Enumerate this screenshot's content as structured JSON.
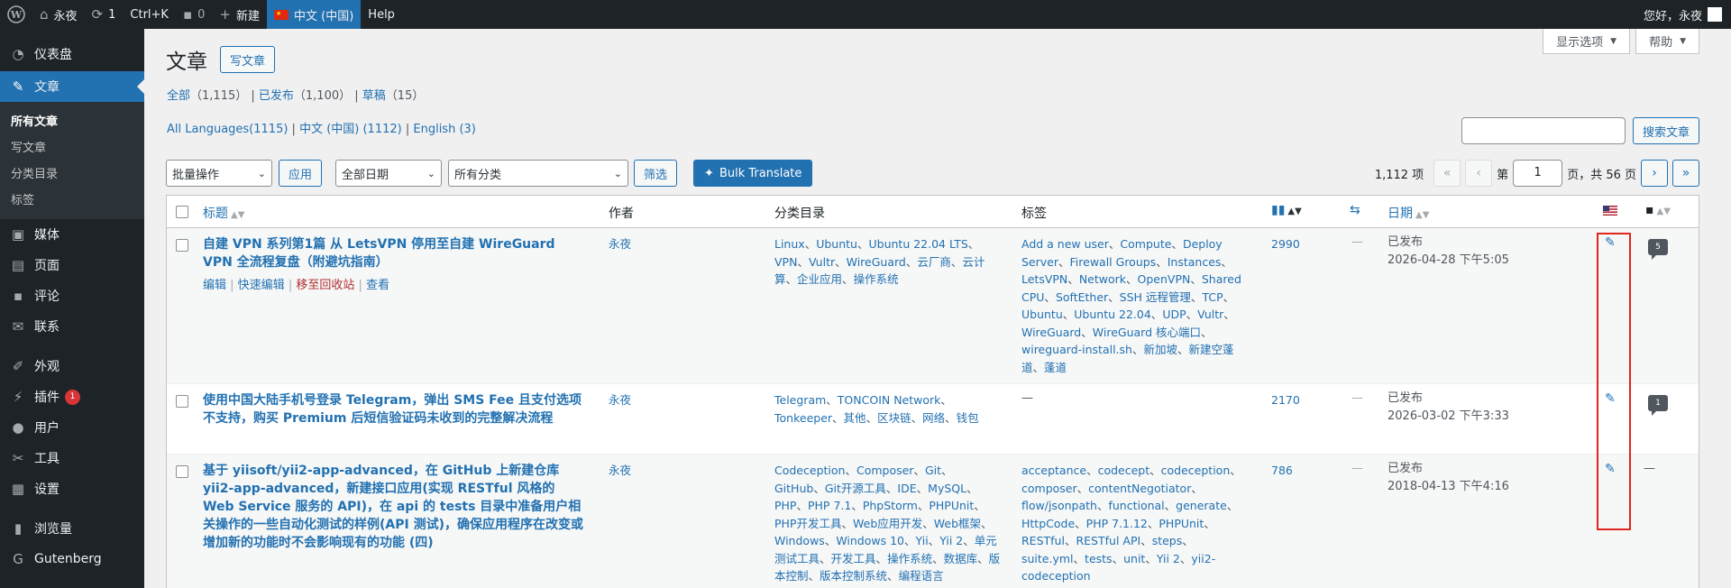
{
  "adminbar": {
    "site_name": "永夜",
    "updates_count": "1",
    "shortcut": "Ctrl+K",
    "comments_count": "0",
    "new_label": "新建",
    "language_label": "中文 (中国)",
    "help_label": "Help",
    "greeting": "您好，永夜"
  },
  "sidebar": {
    "dashboard": "仪表盘",
    "posts": "文章",
    "sub": {
      "all_posts": "所有文章",
      "new_post": "写文章",
      "categories": "分类目录",
      "tags": "标签"
    },
    "media": "媒体",
    "pages": "页面",
    "comments": "评论",
    "contact": "联系",
    "appearance": "外观",
    "plugins": "插件",
    "plugins_badge": "1",
    "users": "用户",
    "tools": "工具",
    "settings": "设置",
    "views": "浏览量",
    "gutenberg": "Gutenberg"
  },
  "screen_meta": {
    "options": "显示选项",
    "help": "帮助"
  },
  "page": {
    "title": "文章",
    "add_new": "写文章"
  },
  "views": {
    "all": "全部",
    "all_count": "（1,115）",
    "published": "已发布",
    "published_count": "（1,100）",
    "drafts": "草稿",
    "drafts_count": "（15）"
  },
  "languages": {
    "all": "All Languages(1115)",
    "zh": "中文 (中国)",
    "zh_count": "(1112)",
    "en": "English",
    "en_count": "(3)"
  },
  "search": {
    "value": "",
    "button": "搜索文章"
  },
  "tablenav": {
    "bulk_action": "批量操作",
    "apply": "应用",
    "date_filter": "全部日期",
    "category_filter": "所有分类",
    "filter": "筛选",
    "bulk_translate": "Bulk Translate",
    "items": "1,112 项",
    "first": "«",
    "prev": "‹",
    "page_prefix": "第",
    "current_page": "1",
    "page_suffix": "页，共 56 页",
    "next": "›",
    "last": "»"
  },
  "columns": {
    "title": "标题",
    "author": "作者",
    "categories": "分类目录",
    "tags": "标签",
    "date": "日期"
  },
  "row_actions": {
    "edit": "编辑",
    "quick_edit": "快速编辑",
    "trash": "移至回收站",
    "view": "查看"
  },
  "posts": [
    {
      "title": "自建 VPN 系列第1篇 从 LetsVPN 停用至自建 WireGuard VPN 全流程复盘（附避坑指南）",
      "author": "永夜",
      "categories": [
        "Linux",
        "Ubuntu",
        "Ubuntu 22.04 LTS",
        "VPN",
        "Vultr",
        "WireGuard",
        "云厂商",
        "云计算",
        "企业应用",
        "操作系统"
      ],
      "tags": [
        "Add a new user",
        "Compute",
        "Deploy Server",
        "Firewall Groups",
        "Instances",
        "LetsVPN",
        "Network",
        "OpenVPN",
        "Shared CPU",
        "SoftEther",
        "SSH 远程管理",
        "TCP",
        "Ubuntu",
        "Ubuntu 22.04",
        "UDP",
        "Vultr",
        "WireGuard",
        "WireGuard 核心端口",
        "wireguard-install.sh",
        "新加坡",
        "新建空蓬道",
        "蓬道"
      ],
      "views": "2990",
      "translation": "—",
      "status": "已发布",
      "date": "2026-04-28 下午5:05",
      "comments": "5"
    },
    {
      "title": "使用中国大陆手机号登录 Telegram，弹出 SMS Fee 且支付选项不支持，购买 Premium 后短信验证码未收到的完整解决流程",
      "author": "永夜",
      "categories": [
        "Telegram",
        "TONCOIN Network",
        "Tonkeeper",
        "其他",
        "区块链",
        "网络",
        "钱包"
      ],
      "tags_empty": "—",
      "views": "2170",
      "translation": "—",
      "status": "已发布",
      "date": "2026-03-02 下午3:33",
      "comments": "1"
    },
    {
      "title": "基于 yiisoft/yii2-app-advanced，在 GitHub 上新建仓库 yii2-app-advanced，新建接口应用(实现 RESTful 风格的 Web Service 服务的 API)，在 api 的 tests 目录中准备用户相关操作的一些自动化测试的样例(API 测试)，确保应用程序在改变或增加新的功能时不会影响现有的功能 (四)",
      "author": "永夜",
      "categories": [
        "Codeception",
        "Composer",
        "Git",
        "GitHub",
        "Git开源工具",
        "IDE",
        "MySQL",
        "PHP",
        "PHP 7.1",
        "PhpStorm",
        "PHPUnit",
        "PHP开发工具",
        "Web应用开发",
        "Web框架",
        "Windows",
        "Windows 10",
        "Yii",
        "Yii 2",
        "单元测试工具",
        "开发工具",
        "操作系统",
        "数据库",
        "版本控制",
        "版本控制系统",
        "编程语言"
      ],
      "tags": [
        "acceptance",
        "codecept",
        "codeception",
        "composer",
        "contentNegotiator",
        "flow/jsonpath",
        "functional",
        "generate",
        "HttpCode",
        "PHP 7.1.12",
        "PHPUnit",
        "RESTful",
        "RESTful API",
        "steps",
        "suite.yml",
        "tests",
        "unit",
        "Yii 2",
        "yii2-codeception"
      ],
      "views": "786",
      "translation": "—",
      "status": "已发布",
      "date": "2018-04-13 下午4:16",
      "comments_empty": "—"
    }
  ]
}
